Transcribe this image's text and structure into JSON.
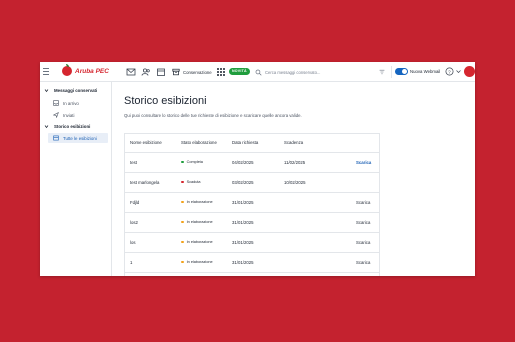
{
  "colors": {
    "page_bg": "#c4222f",
    "brand": "#d5262f",
    "accent": "#1a5fb4",
    "novita": "#1f9d3d",
    "status_completa": "#1f9d3d",
    "status_scaduta": "#d5262f",
    "status_in_elaborazione": "#f2a21b"
  },
  "header": {
    "logo_text": "Aruba PEC",
    "conservazione_label": "Conservazione",
    "novita_badge": "NOVITÀ",
    "search_placeholder": "Cerca messaggi conservato...",
    "nuova_webmail_label": "Nuova Webmail",
    "toggle_on": true,
    "icons": [
      "menu-icon",
      "mail-icon",
      "contacts-icon",
      "calendar-icon",
      "archive-icon",
      "apps-grid-icon",
      "search-icon",
      "filter-icon",
      "help-icon",
      "chevron-down-icon",
      "avatar"
    ]
  },
  "sidebar": {
    "group_messages": "Messaggi conservati",
    "item_in_arrivo": "In arrivo",
    "item_inviati": "Inviati",
    "group_history": "Storico esibizioni",
    "item_tutte": "Tutte le esibizioni"
  },
  "main": {
    "title": "Storico esibizioni",
    "subtitle": "Qui puoi consultare lo storico delle tue richieste di esibizione e scaricare quelle ancora valide."
  },
  "table": {
    "headers": {
      "name": "Nome esibizione",
      "status": "Stato elaborazione",
      "date": "Data richiesta",
      "expiry": "Scadenza"
    },
    "rows": [
      {
        "name": "test",
        "status": "Completa",
        "status_key": "completa",
        "date": "04/02/2025",
        "expiry": "11/02/2025",
        "action": "Scarica",
        "primary": true
      },
      {
        "name": "test marlongela",
        "status": "Scaduta",
        "status_key": "scaduta",
        "date": "03/02/2025",
        "expiry": "10/02/2025",
        "action": "",
        "primary": false
      },
      {
        "name": "Fdjld",
        "status": "In elaborazione",
        "status_key": "in_elaborazione",
        "date": "31/01/2025",
        "expiry": "",
        "action": "Scarica",
        "primary": false
      },
      {
        "name": "los2",
        "status": "In elaborazione",
        "status_key": "in_elaborazione",
        "date": "31/01/2025",
        "expiry": "",
        "action": "Scarica",
        "primary": false
      },
      {
        "name": "los",
        "status": "In elaborazione",
        "status_key": "in_elaborazione",
        "date": "31/01/2025",
        "expiry": "",
        "action": "Scarica",
        "primary": false
      },
      {
        "name": "1",
        "status": "In elaborazione",
        "status_key": "in_elaborazione",
        "date": "31/01/2025",
        "expiry": "",
        "action": "Scarica",
        "primary": false
      },
      {
        "name": "1",
        "status": "In elaborazione",
        "status_key": "in_elaborazione",
        "date": "31/01/2025",
        "expiry": "",
        "action": "Scarica",
        "primary": false
      }
    ]
  }
}
